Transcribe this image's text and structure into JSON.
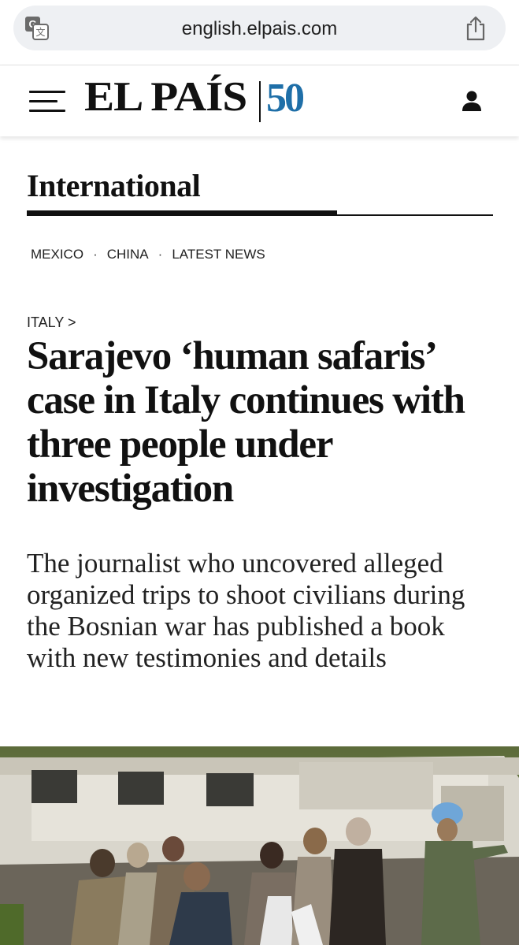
{
  "browser": {
    "url": "english.elpais.com",
    "translate_icon": "translate-icon",
    "share_icon": "share-icon"
  },
  "header": {
    "logo_text": "EL PAÍS",
    "logo_anniversary": "50",
    "menu_icon": "hamburger-menu-icon",
    "user_icon": "user-icon",
    "brand_blue": "#1f6fa8"
  },
  "section": {
    "title": "International",
    "subnav": [
      "MEXICO",
      "CHINA",
      "LATEST NEWS"
    ],
    "separator": "·"
  },
  "article": {
    "kicker": "ITALY >",
    "headline": "Sarajevo ‘human safaris’ case in Italy continues with three people under investigation",
    "dek": "The journalist who uncovered alleged organized trips to shoot civilians during the Bosnian war has published a book with new testimonies and details"
  }
}
